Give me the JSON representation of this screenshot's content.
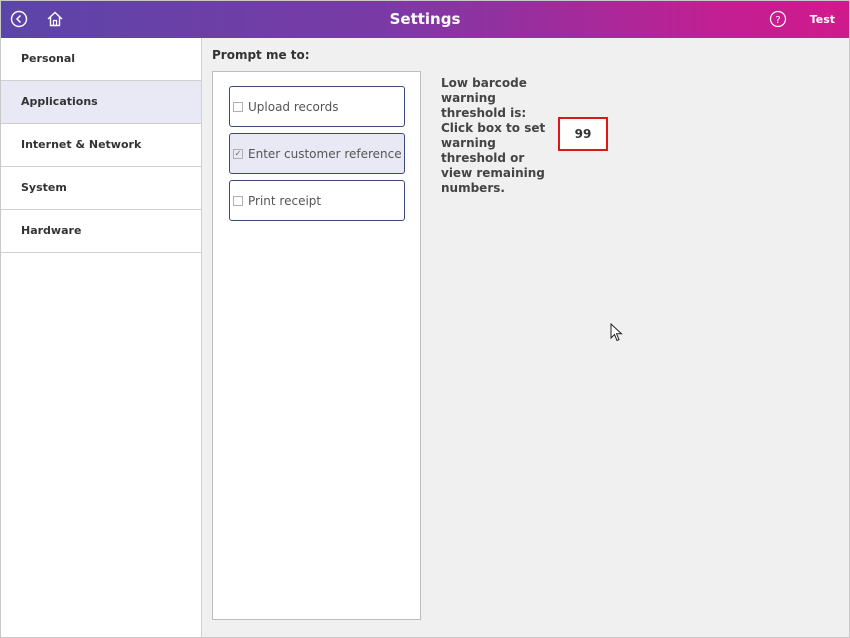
{
  "header": {
    "title": "Settings",
    "user_label": "Test",
    "icons": {
      "back": "back-circle-icon",
      "home": "home-icon",
      "help": "help-circle-icon"
    }
  },
  "sidebar": {
    "items": [
      {
        "label": "Personal",
        "active": false
      },
      {
        "label": "Applications",
        "active": true
      },
      {
        "label": "Internet & Network",
        "active": false
      },
      {
        "label": "System",
        "active": false
      },
      {
        "label": "Hardware",
        "active": false
      }
    ]
  },
  "main": {
    "prompt_label": "Prompt me to:",
    "options": [
      {
        "label": "Upload records",
        "checked": false
      },
      {
        "label": "Enter customer reference",
        "checked": true
      },
      {
        "label": "Print receipt",
        "checked": false
      }
    ],
    "warning_text": "Low barcode warning threshold is: Click box to set warning threshold or view remaining numbers.",
    "threshold_value": "99"
  },
  "colors": {
    "header_start": "#5b45a8",
    "header_end": "#d01a8c",
    "active_bg": "#e9e9f6",
    "highlight_border": "#e01515",
    "option_border": "#3c4a7a"
  }
}
